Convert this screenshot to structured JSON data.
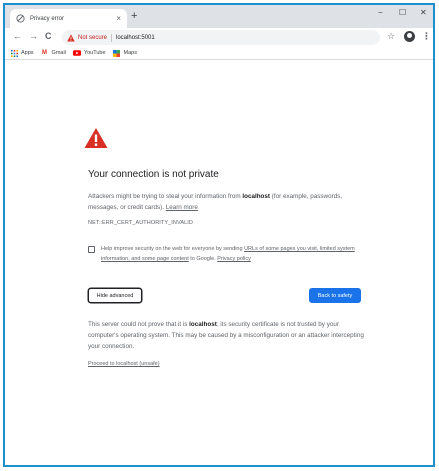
{
  "browser": {
    "tab": {
      "title": "Privacy error",
      "close": "×"
    },
    "new_tab": "+",
    "window_controls": {
      "minimize": "−",
      "maximize": "☐",
      "close": "✕"
    },
    "toolbar": {
      "back": "←",
      "forward": "→",
      "reload": "C",
      "security_label": "Not secure",
      "url": "localhost:5001",
      "star": "☆",
      "menu": "⋮"
    },
    "bookmarks": [
      {
        "label": "Apps",
        "icon": "apps-icon"
      },
      {
        "label": "Gmail",
        "icon": "gmail-icon"
      },
      {
        "label": "YouTube",
        "icon": "youtube-icon"
      },
      {
        "label": "Maps",
        "icon": "maps-icon"
      }
    ]
  },
  "page": {
    "heading": "Your connection is not private",
    "intro_1": "Attackers might be trying to steal your information from ",
    "host": "localhost",
    "intro_2": " (for example, passwords, messages, or credit cards). ",
    "learn_more": "Learn more",
    "error_code": "NET::ERR_CERT_AUTHORITY_INVALID",
    "checkbox_text_1": "Help improve security on the web for everyone by sending ",
    "checkbox_link_1": "URLs of some pages you visit, limited system information, and some page content",
    "checkbox_text_2": " to Google. ",
    "privacy_policy": "Privacy policy",
    "hide_advanced": "Hide advanced",
    "back_to_safety": "Back to safety",
    "details_1": "This server could not prove that it is ",
    "details_host": "localhost",
    "details_2": "; its security certificate is not trusted by your computer's operating system. This may be caused by a misconfiguration or an attacker intercepting your connection.",
    "proceed_link": "Proceed to localhost (unsafe)"
  },
  "colors": {
    "frame_border": "#1d8fce",
    "warning_red": "#d93025",
    "primary_blue": "#1a73e8"
  }
}
